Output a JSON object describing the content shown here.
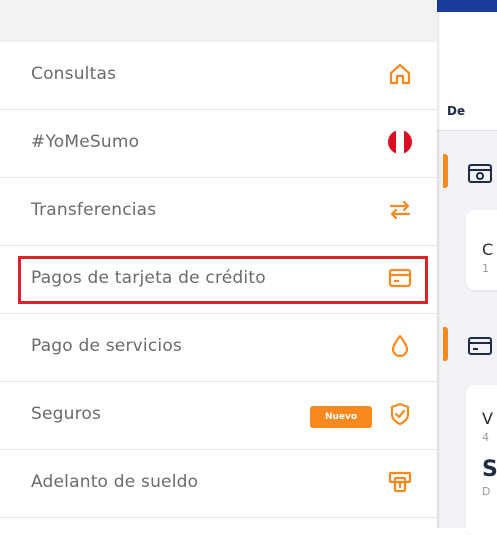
{
  "menu": {
    "items": [
      {
        "label": "Consultas",
        "icon": "home-icon"
      },
      {
        "label": "#YoMeSumo",
        "icon": "peru-flag-icon"
      },
      {
        "label": "Transferencias",
        "icon": "transfer-arrows-icon"
      },
      {
        "label": "Pagos de tarjeta de crédito",
        "icon": "credit-card-icon",
        "highlighted": true
      },
      {
        "label": "Pago de servicios",
        "icon": "drop-icon"
      },
      {
        "label": "Seguros",
        "icon": "shield-check-icon",
        "badge": "Nuevo"
      },
      {
        "label": "Adelanto de sueldo",
        "icon": "cash-advance-icon"
      }
    ]
  },
  "right_panel": {
    "header_text": "De",
    "card1_initial": "C",
    "card1_sub": "1",
    "card2_initial": "V",
    "card2_sub": "4",
    "card2_big": "S",
    "card2_sub2": "D"
  },
  "colors": {
    "accent": "#f7891e",
    "highlight_border": "#d8232a",
    "text": "#6b6b6b",
    "brand_blue": "#1c3c9c"
  }
}
